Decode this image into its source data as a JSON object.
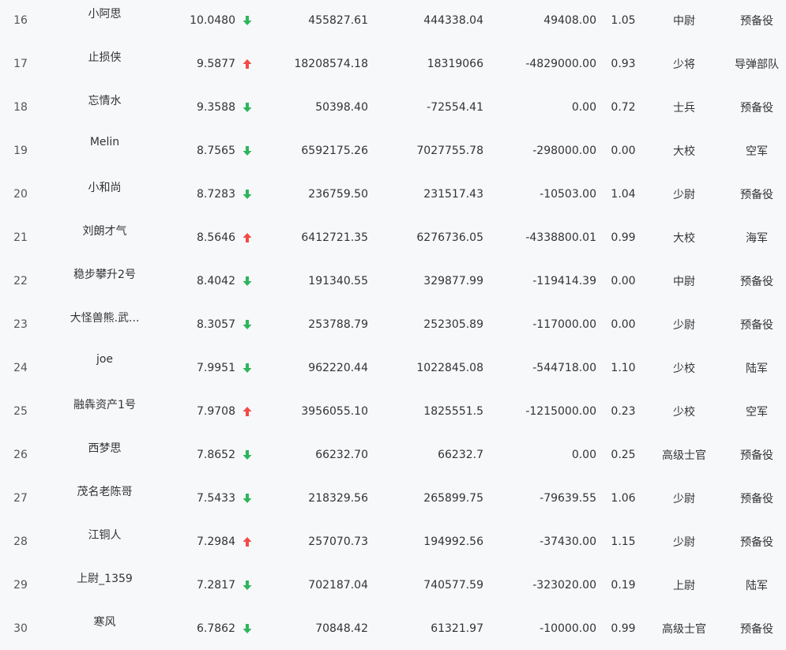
{
  "colors": {
    "down_arrow": "#2db55d",
    "up_arrow": "#f24a45",
    "background": "#f7f8fa",
    "text": "#333333"
  },
  "rows": [
    {
      "rank": "16",
      "name": "小阿思",
      "score": "10.0480",
      "trend": "down",
      "col1": "455827.61",
      "col2": "444338.04",
      "col3": "49408.00",
      "col4": "1.05",
      "rank_title": "中尉",
      "branch": "预备役"
    },
    {
      "rank": "17",
      "name": "止损侠",
      "score": "9.5877",
      "trend": "up",
      "col1": "18208574.18",
      "col2": "18319066",
      "col3": "-4829000.00",
      "col4": "0.93",
      "rank_title": "少将",
      "branch": "导弹部队"
    },
    {
      "rank": "18",
      "name": "忘情水",
      "score": "9.3588",
      "trend": "down",
      "col1": "50398.40",
      "col2": "-72554.41",
      "col3": "0.00",
      "col4": "0.72",
      "rank_title": "士兵",
      "branch": "预备役"
    },
    {
      "rank": "19",
      "name": "Melin",
      "score": "8.7565",
      "trend": "down",
      "col1": "6592175.26",
      "col2": "7027755.78",
      "col3": "-298000.00",
      "col4": "0.00",
      "rank_title": "大校",
      "branch": "空军"
    },
    {
      "rank": "20",
      "name": "小和尚",
      "score": "8.7283",
      "trend": "down",
      "col1": "236759.50",
      "col2": "231517.43",
      "col3": "-10503.00",
      "col4": "1.04",
      "rank_title": "少尉",
      "branch": "预备役"
    },
    {
      "rank": "21",
      "name": "刘朗才气",
      "score": "8.5646",
      "trend": "up",
      "col1": "6412721.35",
      "col2": "6276736.05",
      "col3": "-4338800.01",
      "col4": "0.99",
      "rank_title": "大校",
      "branch": "海军"
    },
    {
      "rank": "22",
      "name": "稳步攀升2号",
      "score": "8.4042",
      "trend": "down",
      "col1": "191340.55",
      "col2": "329877.99",
      "col3": "-119414.39",
      "col4": "0.00",
      "rank_title": "中尉",
      "branch": "预备役"
    },
    {
      "rank": "23",
      "name": "大怪兽熊.武...",
      "score": "8.3057",
      "trend": "down",
      "col1": "253788.79",
      "col2": "252305.89",
      "col3": "-117000.00",
      "col4": "0.00",
      "rank_title": "少尉",
      "branch": "预备役"
    },
    {
      "rank": "24",
      "name": "joe",
      "score": "7.9951",
      "trend": "down",
      "col1": "962220.44",
      "col2": "1022845.08",
      "col3": "-544718.00",
      "col4": "1.10",
      "rank_title": "少校",
      "branch": "陆军"
    },
    {
      "rank": "25",
      "name": "融犇资产1号",
      "score": "7.9708",
      "trend": "up",
      "col1": "3956055.10",
      "col2": "1825551.5",
      "col3": "-1215000.00",
      "col4": "0.23",
      "rank_title": "少校",
      "branch": "空军"
    },
    {
      "rank": "26",
      "name": "西梦思",
      "score": "7.8652",
      "trend": "down",
      "col1": "66232.70",
      "col2": "66232.7",
      "col3": "0.00",
      "col4": "0.25",
      "rank_title": "高级士官",
      "branch": "预备役"
    },
    {
      "rank": "27",
      "name": "茂名老陈哥",
      "score": "7.5433",
      "trend": "down",
      "col1": "218329.56",
      "col2": "265899.75",
      "col3": "-79639.55",
      "col4": "1.06",
      "rank_title": "少尉",
      "branch": "预备役"
    },
    {
      "rank": "28",
      "name": "江铜人",
      "score": "7.2984",
      "trend": "up",
      "col1": "257070.73",
      "col2": "194992.56",
      "col3": "-37430.00",
      "col4": "1.15",
      "rank_title": "少尉",
      "branch": "预备役"
    },
    {
      "rank": "29",
      "name": "上尉_1359",
      "score": "7.2817",
      "trend": "down",
      "col1": "702187.04",
      "col2": "740577.59",
      "col3": "-323020.00",
      "col4": "0.19",
      "rank_title": "上尉",
      "branch": "陆军"
    },
    {
      "rank": "30",
      "name": "寒风",
      "score": "6.7862",
      "trend": "down",
      "col1": "70848.42",
      "col2": "61321.97",
      "col3": "-10000.00",
      "col4": "0.99",
      "rank_title": "高级士官",
      "branch": "预备役"
    }
  ]
}
